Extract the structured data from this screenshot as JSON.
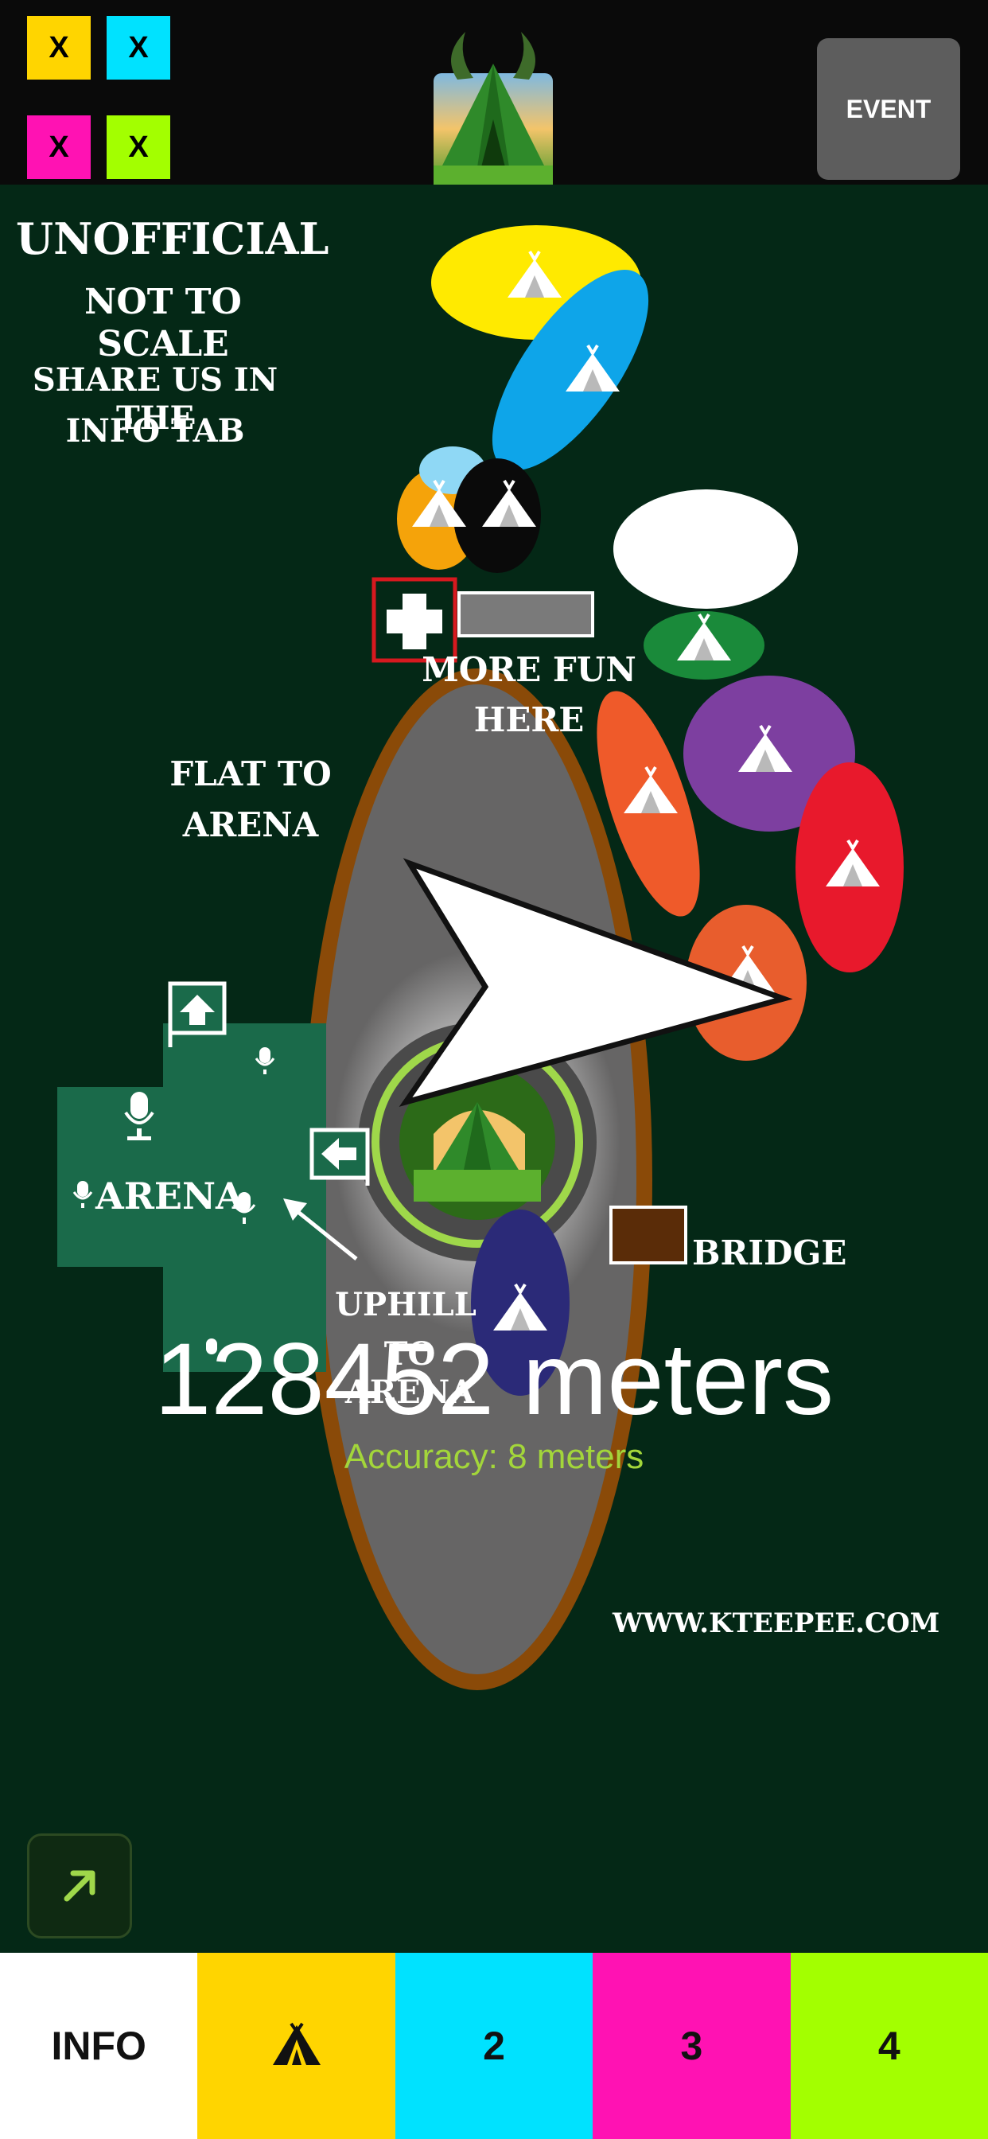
{
  "topbar": {
    "squares": [
      {
        "label": "X",
        "color": "#ffd500"
      },
      {
        "label": "X",
        "color": "#00e2ff"
      },
      {
        "label": "X",
        "color": "#ff12b3"
      },
      {
        "label": "X",
        "color": "#a3ff00"
      }
    ],
    "event_label": "EVENT"
  },
  "map": {
    "notes": {
      "unofficial": "UNOFFICIAL",
      "not_to_scale": "NOT TO SCALE",
      "share_line1": "SHARE US IN THE",
      "share_line2": "INFO TAB"
    },
    "labels": {
      "more_fun_line1": "MORE FUN",
      "more_fun_line2": "HERE",
      "flat_line1": "FLAT TO",
      "flat_line2": "ARENA",
      "arena": "ARENA",
      "uphill_line1": "UPHILL",
      "uphill_line2": "TO ARENA",
      "bridge": "BRIDGE",
      "website": "WWW.KTEEPEE.COM"
    },
    "camp_colors": [
      "#ffea00",
      "#0ea5e9",
      "#f5a30a",
      "#0a0a0a",
      "#ffffff",
      "#1a8a3a",
      "#ef5a2a",
      "#7d3fa0",
      "#e8192c",
      "#e85d2d",
      "#2b2a78"
    ],
    "distance_text": "128452 meters",
    "accuracy_text": "Accuracy: 8 meters"
  },
  "tabs": [
    {
      "label": "INFO",
      "color": "#ffffff"
    },
    {
      "icon": "tent-icon",
      "color": "#ffd500"
    },
    {
      "label": "2",
      "color": "#00e2ff"
    },
    {
      "label": "3",
      "color": "#ff12b3"
    },
    {
      "label": "4",
      "color": "#a3ff00"
    }
  ]
}
